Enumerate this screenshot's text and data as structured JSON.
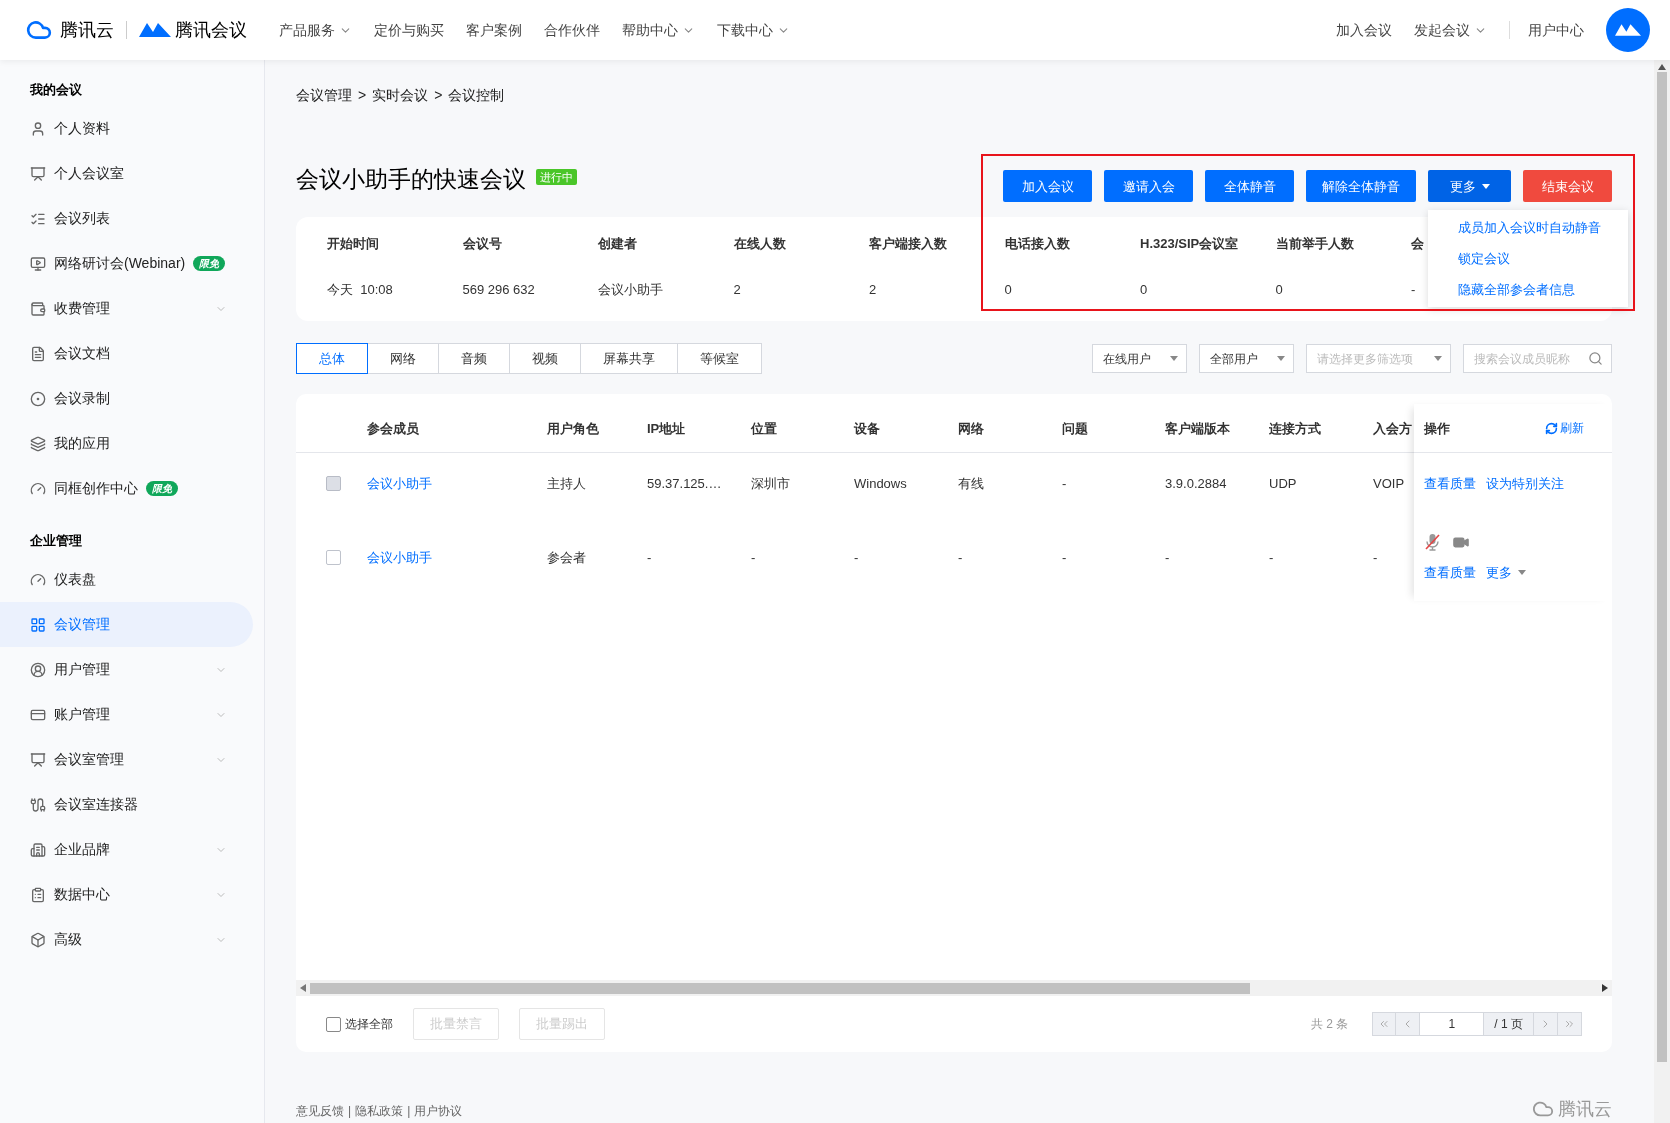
{
  "top_nav": {
    "brand": "腾讯云",
    "product": "腾讯会议",
    "menu": [
      {
        "label": "产品服务",
        "dropdown": true
      },
      {
        "label": "定价与购买",
        "dropdown": false
      },
      {
        "label": "客户案例",
        "dropdown": false
      },
      {
        "label": "合作伙伴",
        "dropdown": false
      },
      {
        "label": "帮助中心",
        "dropdown": true
      },
      {
        "label": "下载中心",
        "dropdown": true
      }
    ],
    "right": [
      {
        "label": "加入会议",
        "dropdown": false
      },
      {
        "label": "发起会议",
        "dropdown": true
      },
      {
        "label": "用户中心",
        "dropdown": false
      }
    ]
  },
  "sidebar": {
    "sections": [
      {
        "title": "我的会议",
        "items": [
          {
            "label": "个人资料",
            "expandable": false,
            "selected": false
          },
          {
            "label": "个人会议室",
            "expandable": false,
            "selected": false
          },
          {
            "label": "会议列表",
            "expandable": false,
            "selected": false
          },
          {
            "label": "网络研讨会(Webinar)",
            "badge": "限免",
            "expandable": false,
            "selected": false
          },
          {
            "label": "收费管理",
            "expandable": true,
            "selected": false
          },
          {
            "label": "会议文档",
            "expandable": false,
            "selected": false
          },
          {
            "label": "会议录制",
            "expandable": false,
            "selected": false
          },
          {
            "label": "我的应用",
            "expandable": false,
            "selected": false
          },
          {
            "label": "同框创作中心",
            "badge": "限免",
            "expandable": false,
            "selected": false
          }
        ]
      },
      {
        "title": "企业管理",
        "items": [
          {
            "label": "仪表盘",
            "expandable": false,
            "selected": false
          },
          {
            "label": "会议管理",
            "expandable": false,
            "selected": true
          },
          {
            "label": "用户管理",
            "expandable": true,
            "selected": false
          },
          {
            "label": "账户管理",
            "expandable": true,
            "selected": false
          },
          {
            "label": "会议室管理",
            "expandable": true,
            "selected": false
          },
          {
            "label": "会议室连接器",
            "expandable": false,
            "selected": false
          },
          {
            "label": "企业品牌",
            "expandable": true,
            "selected": false
          },
          {
            "label": "数据中心",
            "expandable": true,
            "selected": false
          },
          {
            "label": "高级",
            "expandable": true,
            "selected": false
          }
        ]
      }
    ]
  },
  "breadcrumb": {
    "items": [
      "会议管理",
      "实时会议",
      "会议控制"
    ],
    "separator": ">"
  },
  "meeting": {
    "title": "会议小助手的快速会议",
    "status": "进行中"
  },
  "actions": [
    {
      "label": "加入会议",
      "kind": "primary"
    },
    {
      "label": "邀请入会",
      "kind": "primary"
    },
    {
      "label": "全体静音",
      "kind": "primary"
    },
    {
      "label": "解除全体静音",
      "kind": "primary"
    },
    {
      "label": "更多",
      "kind": "dropdown",
      "expanded": true,
      "menu": [
        "成员加入会议时自动静音",
        "锁定会议",
        "隐藏全部参会者信息"
      ]
    },
    {
      "label": "结束会议",
      "kind": "danger"
    }
  ],
  "stats": [
    {
      "label": "开始时间",
      "value": "今天  10:08"
    },
    {
      "label": "会议号",
      "value": "569 296 632"
    },
    {
      "label": "创建者",
      "value": "会议小助手"
    },
    {
      "label": "在线人数",
      "value": "2"
    },
    {
      "label": "客户端接入数",
      "value": "2"
    },
    {
      "label": "电话接入数",
      "value": "0"
    },
    {
      "label": "H.323/SIP会议室",
      "value": "0"
    },
    {
      "label": "当前举手人数",
      "value": "0"
    },
    {
      "label": "会",
      "value": "-"
    }
  ],
  "tabs": [
    {
      "label": "总体",
      "selected": true
    },
    {
      "label": "网络",
      "selected": false
    },
    {
      "label": "音频",
      "selected": false
    },
    {
      "label": "视频",
      "selected": false
    },
    {
      "label": "屏幕共享",
      "selected": false
    },
    {
      "label": "等候室",
      "selected": false
    }
  ],
  "filters": [
    {
      "value": "在线用户"
    },
    {
      "value": "全部用户"
    },
    {
      "placeholder": "请选择更多筛选项"
    }
  ],
  "search": {
    "placeholder": "搜索会议成员昵称"
  },
  "table": {
    "columns": [
      "参会成员",
      "用户角色",
      "IP地址",
      "位置",
      "设备",
      "网络",
      "问题",
      "客户端版本",
      "连接方式",
      "入会方"
    ],
    "actions_column": "操作",
    "refresh": "刷新",
    "rows": [
      {
        "checked": false,
        "disabled": true,
        "cells": [
          "会议小助手",
          "主持人",
          "59.37.125.…",
          "深圳市",
          "Windows",
          "有线",
          "-",
          "3.9.0.2884",
          "UDP",
          "VOIP"
        ],
        "links": [
          "查看质量",
          "设为特别关注"
        ]
      },
      {
        "checked": false,
        "disabled": false,
        "cells": [
          "会议小助手",
          "参会者",
          "-",
          "-",
          "-",
          "-",
          "-",
          "-",
          "-",
          "-"
        ],
        "mic_muted": true,
        "links": [
          "查看质量"
        ],
        "more": "更多"
      }
    ]
  },
  "table_footer": {
    "select_all": {
      "label": "选择全部",
      "checked": false
    },
    "batch": [
      {
        "label": "批量禁言",
        "disabled": true
      },
      {
        "label": "批量踢出",
        "disabled": true
      }
    ],
    "total": "共 2 条",
    "page": "1",
    "pages": "/ 1 页"
  },
  "page_footer": {
    "links": [
      "意见反馈",
      "隐私政策",
      "用户协议"
    ],
    "separator": "|",
    "logo": "腾讯云"
  }
}
